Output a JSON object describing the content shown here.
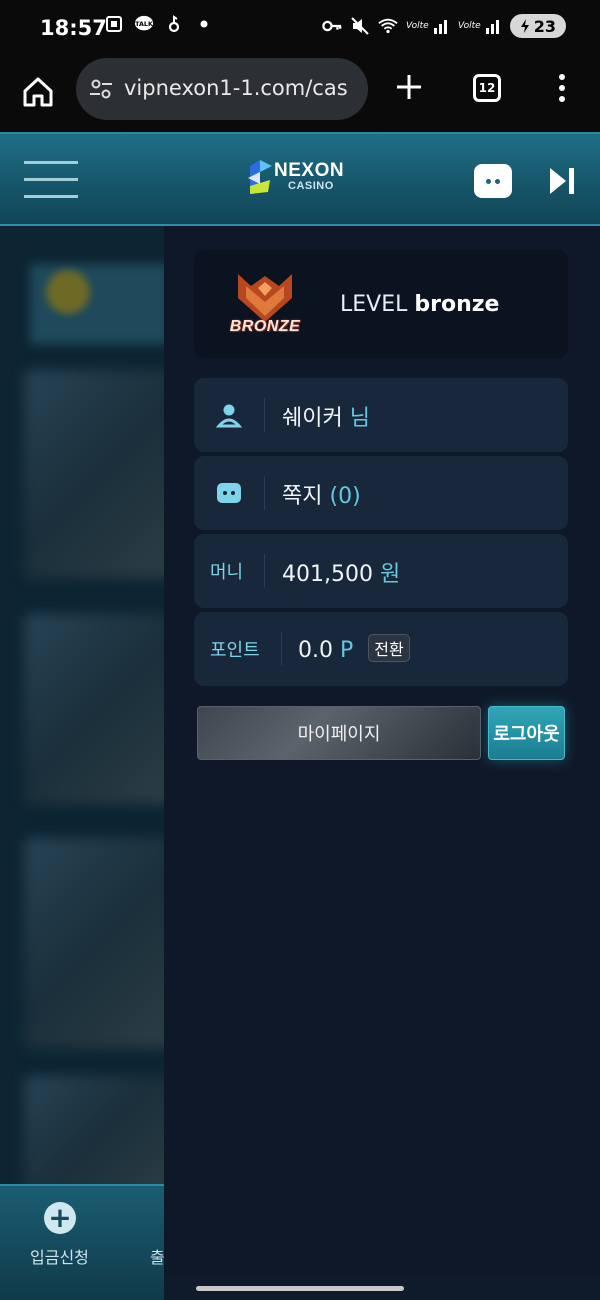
{
  "status_bar": {
    "time": "18:57",
    "battery": "23",
    "icons": [
      "screenshot-icon",
      "kakaotalk-icon",
      "notification-icon",
      "dot-icon",
      "key-icon",
      "mute-icon",
      "wifi-icon",
      "volte-signal-icon",
      "volte-signal-icon",
      "battery-icon"
    ]
  },
  "browser": {
    "url": "vipnexon1-1.com/cas",
    "tab_count": "12"
  },
  "header": {
    "logo_line1": "NEXON",
    "logo_line2": "CASINO"
  },
  "panel": {
    "badge_text": "BRONZE",
    "level_prefix": "LEVEL",
    "level_value": "bronze",
    "user_name": "쉐이커",
    "user_suffix": "님",
    "messages_label": "쪽지",
    "messages_count": "(0)",
    "money_label": "머니",
    "money_value": "401,500",
    "money_unit": "원",
    "points_label": "포인트",
    "points_value": "0.0",
    "points_unit": "P",
    "convert_label": "전환",
    "mypage_label": "마이페이지",
    "logout_label": "로그아웃"
  },
  "bottom_nav": {
    "deposit_label": "입금신청",
    "withdraw_label": "출"
  },
  "colors": {
    "accent": "#63c9e3",
    "header": "#1f6f86",
    "panel_bg": "#0f1828",
    "row_bg": "#18273a"
  }
}
